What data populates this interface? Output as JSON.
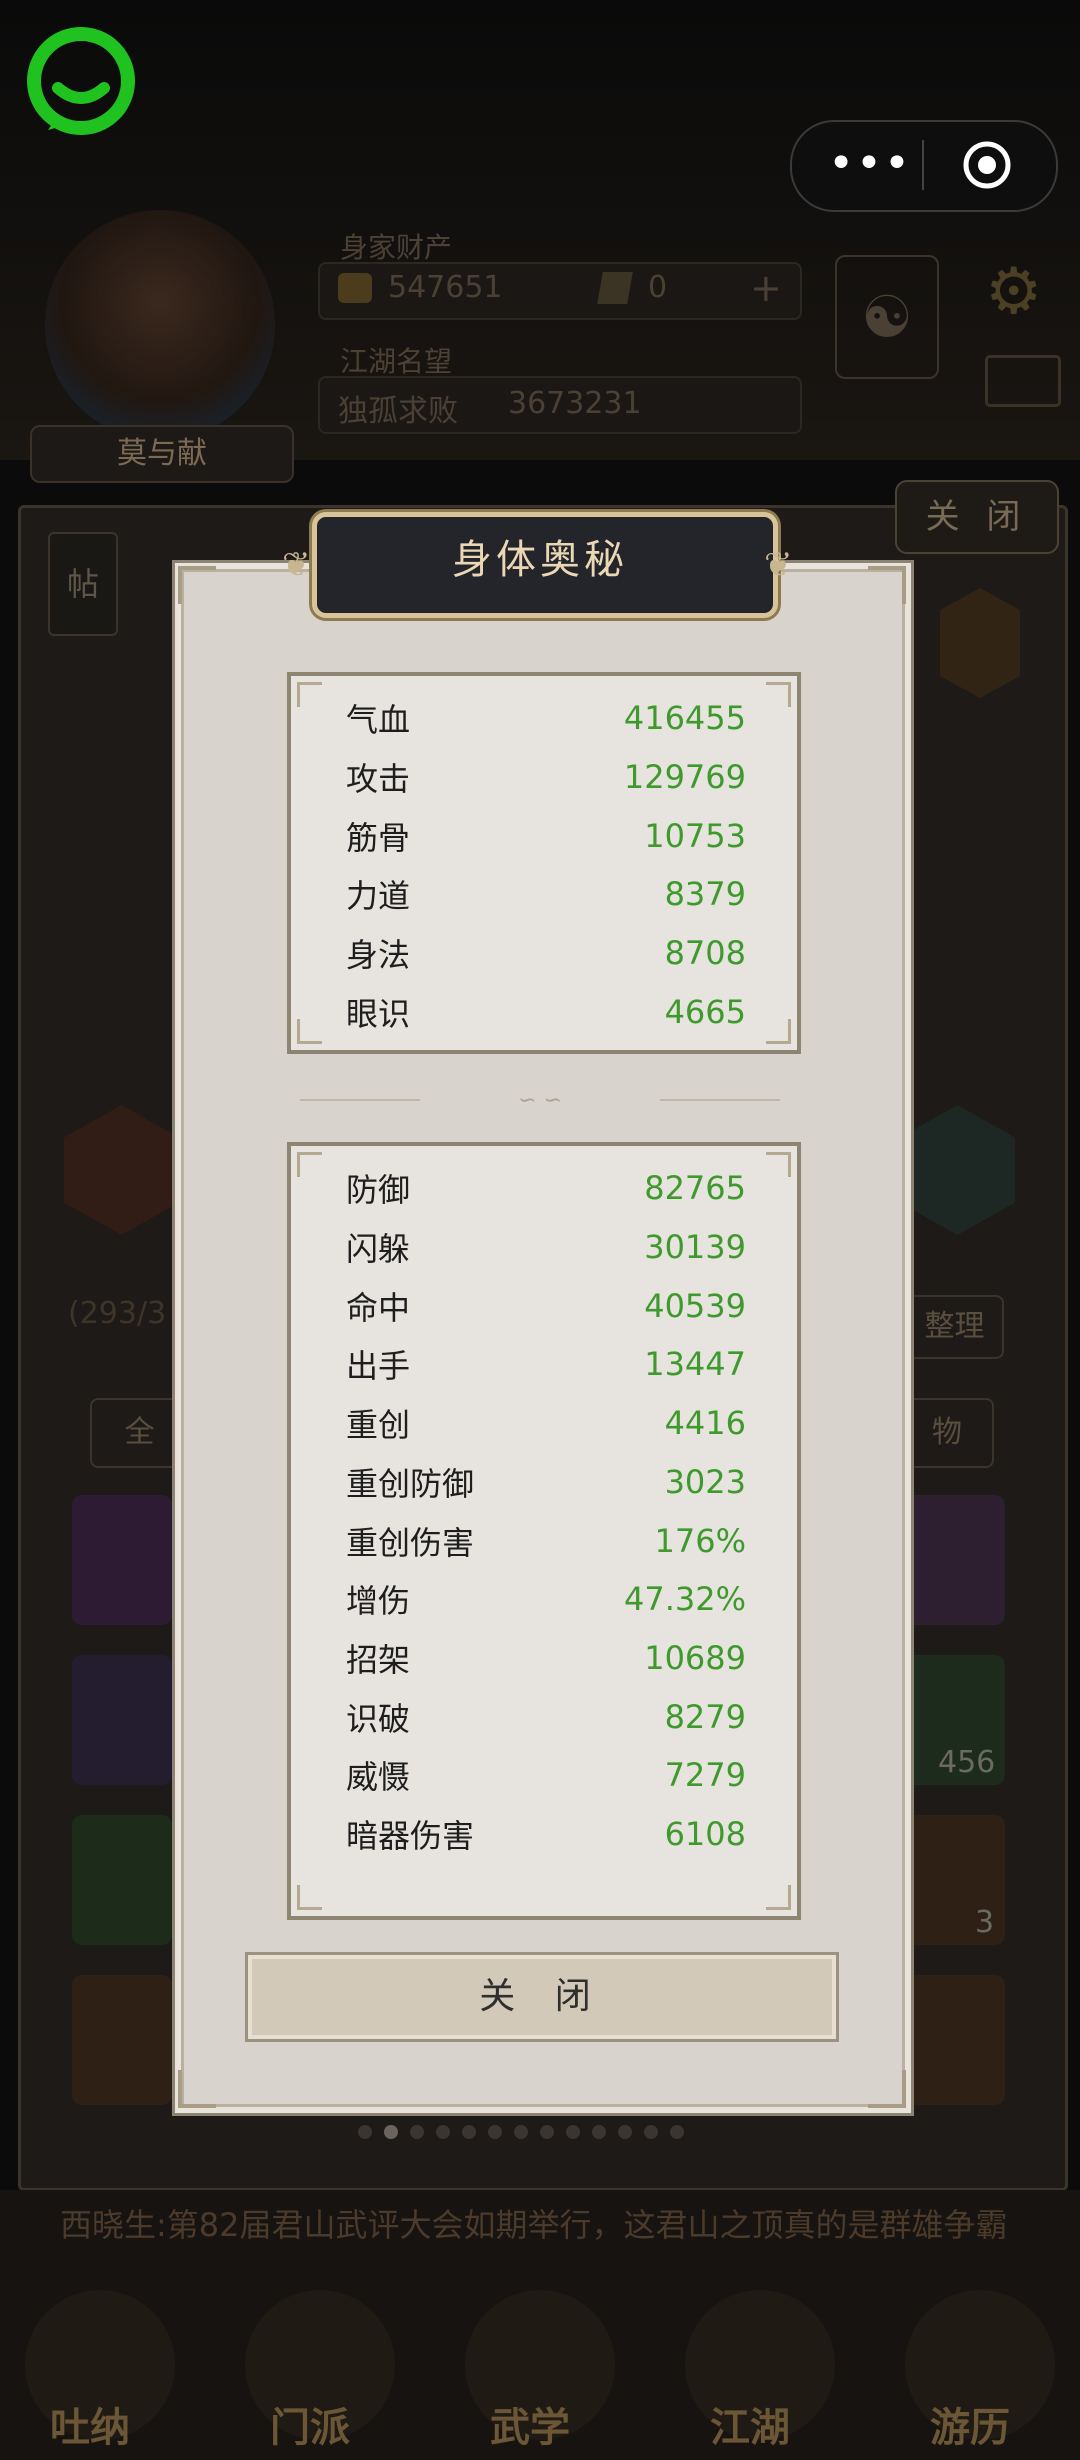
{
  "capsule": {
    "more_glyph": "•••",
    "target_icon": "record-icon"
  },
  "profile": {
    "name": "莫与献",
    "wealth_label": "身家财产",
    "gold": "547651",
    "tickets": "0",
    "reputation_label": "江湖名望",
    "reputation_title": "独孤求败",
    "reputation_value": "3673231"
  },
  "background": {
    "close_label": "关 闭",
    "tab_all": "全",
    "tab_items": "物",
    "sort_label": "整理",
    "capacity": "(293/3",
    "qty_456": "456",
    "qty_3": "3",
    "left_tag": "帖",
    "ticker": "西晓生:第82届君山武评大会如期举行，这君山之顶真的是群雄争霸"
  },
  "nav": [
    {
      "label": "吐纳"
    },
    {
      "label": "门派"
    },
    {
      "label": "武学"
    },
    {
      "label": "江湖"
    },
    {
      "label": "游历"
    }
  ],
  "modal": {
    "title": "身体奥秘",
    "close_button": "关 闭",
    "base_stats": [
      {
        "name": "气血",
        "value": "416455"
      },
      {
        "name": "攻击",
        "value": "129769"
      },
      {
        "name": "筋骨",
        "value": "10753"
      },
      {
        "name": "力道",
        "value": "8379"
      },
      {
        "name": "身法",
        "value": "8708"
      },
      {
        "name": "眼识",
        "value": "4665"
      }
    ],
    "combat_stats": [
      {
        "name": "防御",
        "value": "82765"
      },
      {
        "name": "闪躲",
        "value": "30139"
      },
      {
        "name": "命中",
        "value": "40539"
      },
      {
        "name": "出手",
        "value": "13447"
      },
      {
        "name": "重创",
        "value": "4416"
      },
      {
        "name": "重创防御",
        "value": "3023"
      },
      {
        "name": "重创伤害",
        "value": "176%"
      },
      {
        "name": "增伤",
        "value": "47.32%"
      },
      {
        "name": "招架",
        "value": "10689"
      },
      {
        "name": "识破",
        "value": "8279"
      },
      {
        "name": "威慑",
        "value": "7279"
      },
      {
        "name": "暗器伤害",
        "value": "6108"
      }
    ]
  },
  "colors": {
    "stat_value": "#3e9a2c",
    "logo_green": "#1fc21f"
  }
}
